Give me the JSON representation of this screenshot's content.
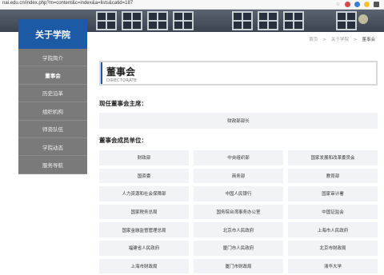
{
  "browser": {
    "url": "nai.edu.cn/index.php?m=content&c=index&a=lists&catid=187"
  },
  "sidebar": {
    "title": "关于学院",
    "items": [
      {
        "label": "学院简介"
      },
      {
        "label": "董事会"
      },
      {
        "label": "历史沿革"
      },
      {
        "label": "组织机构"
      },
      {
        "label": "师资队伍"
      },
      {
        "label": "学院动态"
      },
      {
        "label": "服务导航"
      }
    ]
  },
  "breadcrumb": {
    "items": [
      "首页",
      "关于学院",
      "董事会"
    ],
    "separator": ">"
  },
  "header": {
    "title": "董事会",
    "subtitle": "DIRECTORATE"
  },
  "chair_section": {
    "heading": "现任董事会主席：",
    "value": "财政部部长"
  },
  "members_section": {
    "heading": "董事会成员单位：",
    "members": [
      "财政部",
      "中央组织部",
      "国家发展和改革委员会",
      "国资委",
      "商务部",
      "教育部",
      "人力资源和社会保障部",
      "中国人民银行",
      "国家审计署",
      "国家税务总局",
      "国务院台湾事务办公室",
      "中国证监会",
      "国家金融监督管理总局",
      "北京市人民政府",
      "上海市人民政府",
      "福建省人民政府",
      "厦门市人民政府",
      "北京市财政局",
      "上海市财政局",
      "厦门市财政局",
      "清华大学"
    ]
  },
  "colors": {
    "brand": "#1c5aa6",
    "sidebar_bg": "#7a7a7a",
    "cell_bg": "#f2f3f7"
  }
}
